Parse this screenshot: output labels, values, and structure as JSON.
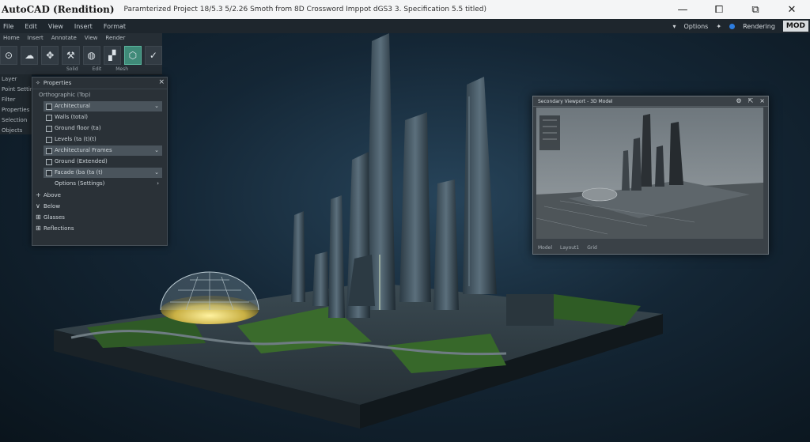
{
  "titlebar": {
    "app_title": "AutoCAD (Rendition)",
    "doc_title": "Paramterized Project 18/5.3 5/2.26 Smoth from 8D Crossword Imppot dGS3 3. Specification 5.5 titled)",
    "controls": [
      "—",
      "⧠",
      "⧉",
      "✕"
    ]
  },
  "menubar": {
    "items": [
      "File",
      "Edit",
      "View",
      "Insert",
      "Format"
    ],
    "right": {
      "item1": "Options",
      "item2": "Rendering",
      "mode": "MOD"
    }
  },
  "ribbon": {
    "tabs": [
      "Home",
      "Insert",
      "Annotate",
      "View",
      "Render"
    ],
    "labels": [
      "Solid",
      "Edit",
      "Mesh"
    ]
  },
  "leftlist": {
    "items": [
      "Layer",
      "Point Settings",
      "Filter",
      "Properties",
      "Selection",
      "Objects"
    ]
  },
  "palette": {
    "header": "Properties",
    "subtitle": "Orthographic (Top)",
    "rows": [
      {
        "label": "Architectural",
        "highlight": true,
        "arrow": "⌄"
      },
      {
        "label": "Walls (total)",
        "highlight": false,
        "arrow": ""
      },
      {
        "label": "Ground floor (ta)",
        "highlight": false,
        "arrow": ""
      },
      {
        "label": "Levels (ta (t)(t)",
        "highlight": false,
        "arrow": ""
      },
      {
        "label": "Architectural Frames",
        "highlight": true,
        "arrow": "⌄"
      },
      {
        "label": "Ground (Extended)",
        "highlight": false,
        "arrow": ""
      },
      {
        "label": "Facade (ba (ta (t)",
        "highlight": true,
        "arrow": "⌄"
      },
      {
        "label": "Options (Settings)",
        "highlight": false,
        "arrow": "›"
      }
    ],
    "tree": [
      {
        "mark": "+",
        "label": "Above"
      },
      {
        "mark": "∨",
        "label": "Below"
      },
      {
        "mark": "⊞",
        "label": "Glasses"
      },
      {
        "mark": "⊞",
        "label": "Reflections"
      }
    ]
  },
  "subwin": {
    "title": "Secondary Viewport - 3D Model",
    "status": [
      "Model",
      "Layout1",
      "Grid"
    ]
  }
}
